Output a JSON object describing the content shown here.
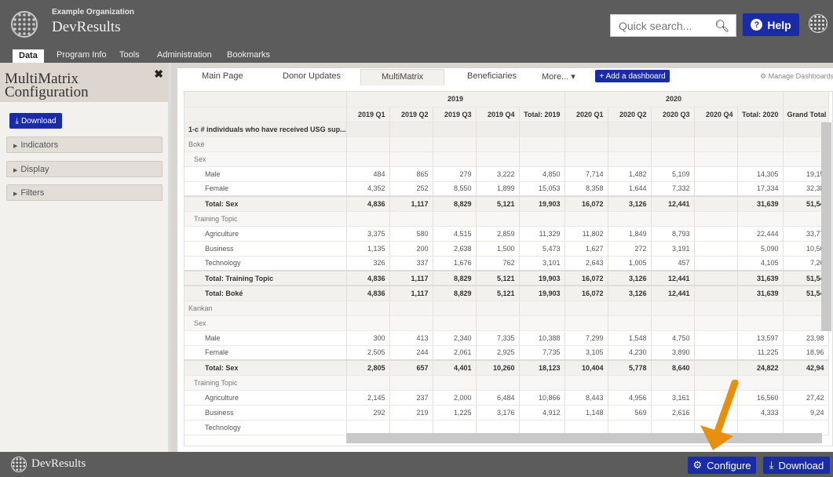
{
  "header": {
    "org_name": "Example Organization",
    "app_name": "DevResults",
    "search_placeholder": "Quick search...",
    "help_label": "Help"
  },
  "nav": [
    "Data",
    "Program Info",
    "Tools",
    "Administration",
    "Bookmarks"
  ],
  "sidebar": {
    "title": "MultiMatrix Configuration",
    "download_label": "Download",
    "sections": [
      "Indicators",
      "Display",
      "Filters"
    ]
  },
  "tabs": [
    "Main Page",
    "Donor Updates",
    "MultiMatrix",
    "Beneficiaries",
    "More..."
  ],
  "add_dashboard_label": "+ Add a dashboard",
  "manage_label": "Manage Dashboards",
  "table": {
    "year_headers": [
      "2019",
      "2020"
    ],
    "columns": [
      "2019 Q1",
      "2019 Q2",
      "2019 Q3",
      "2019 Q4",
      "Total: 2019",
      "2020 Q1",
      "2020 Q2",
      "2020 Q3",
      "2020 Q4",
      "Total: 2020",
      "Grand Total"
    ],
    "rows": [
      {
        "type": "ind",
        "label": "1-c # individuals who have received USG sup...",
        "values": []
      },
      {
        "type": "grp",
        "label": "Boké",
        "values": []
      },
      {
        "type": "sub",
        "label": "Sex",
        "values": []
      },
      {
        "type": "data",
        "label": "Male",
        "values": [
          "484",
          "865",
          "279",
          "3,222",
          "4,850",
          "7,714",
          "1,482",
          "5,109",
          "",
          "14,305",
          "19,15"
        ]
      },
      {
        "type": "data",
        "label": "Female",
        "values": [
          "4,352",
          "252",
          "8,550",
          "1,899",
          "15,053",
          "8,358",
          "1,644",
          "7,332",
          "",
          "17,334",
          "32,38"
        ]
      },
      {
        "type": "total",
        "label": "Total: Sex",
        "values": [
          "4,836",
          "1,117",
          "8,829",
          "5,121",
          "19,903",
          "16,072",
          "3,126",
          "12,441",
          "",
          "31,639",
          "51,54"
        ]
      },
      {
        "type": "sub",
        "label": "Training Topic",
        "values": []
      },
      {
        "type": "data",
        "label": "Agriculture",
        "values": [
          "3,375",
          "580",
          "4,515",
          "2,859",
          "11,329",
          "11,802",
          "1,849",
          "8,793",
          "",
          "22,444",
          "33,77"
        ]
      },
      {
        "type": "data",
        "label": "Business",
        "values": [
          "1,135",
          "200",
          "2,638",
          "1,500",
          "5,473",
          "1,627",
          "272",
          "3,191",
          "",
          "5,090",
          "10,56"
        ]
      },
      {
        "type": "data",
        "label": "Technology",
        "values": [
          "326",
          "337",
          "1,676",
          "762",
          "3,101",
          "2,643",
          "1,005",
          "457",
          "",
          "4,105",
          "7,20"
        ]
      },
      {
        "type": "total",
        "label": "Total: Training Topic",
        "values": [
          "4,836",
          "1,117",
          "8,829",
          "5,121",
          "19,903",
          "16,072",
          "3,126",
          "12,441",
          "",
          "31,639",
          "51,54"
        ]
      },
      {
        "type": "total",
        "label": "Total: Boké",
        "values": [
          "4,836",
          "1,117",
          "8,829",
          "5,121",
          "19,903",
          "16,072",
          "3,126",
          "12,441",
          "",
          "31,639",
          "51,54"
        ]
      },
      {
        "type": "grp",
        "label": "Kankan",
        "values": []
      },
      {
        "type": "sub",
        "label": "Sex",
        "values": []
      },
      {
        "type": "data",
        "label": "Male",
        "values": [
          "300",
          "413",
          "2,340",
          "7,335",
          "10,388",
          "7,299",
          "1,548",
          "4,750",
          "",
          "13,597",
          "23,98"
        ]
      },
      {
        "type": "data",
        "label": "Female",
        "values": [
          "2,505",
          "244",
          "2,061",
          "2,925",
          "7,735",
          "3,105",
          "4,230",
          "3,890",
          "",
          "11,225",
          "18,96"
        ]
      },
      {
        "type": "total",
        "label": "Total: Sex",
        "values": [
          "2,805",
          "657",
          "4,401",
          "10,260",
          "18,123",
          "10,404",
          "5,778",
          "8,640",
          "",
          "24,822",
          "42,94"
        ]
      },
      {
        "type": "sub",
        "label": "Training Topic",
        "values": []
      },
      {
        "type": "data",
        "label": "Agriculture",
        "values": [
          "2,145",
          "237",
          "2,000",
          "6,484",
          "10,866",
          "8,443",
          "4,956",
          "3,161",
          "",
          "16,560",
          "27,42"
        ]
      },
      {
        "type": "data",
        "label": "Business",
        "values": [
          "292",
          "219",
          "1,225",
          "3,176",
          "4,912",
          "1,148",
          "569",
          "2,616",
          "",
          "4,333",
          "9,24"
        ]
      },
      {
        "type": "data",
        "label": "Technology",
        "values": [
          "",
          "",
          "",
          "",
          "",
          "",
          "",
          "",
          "",
          "",
          ""
        ]
      }
    ]
  },
  "footer": {
    "brand": "DevResults",
    "configure_label": "Configure",
    "download_label": "Download"
  },
  "colors": {
    "accent": "#1a2ba8",
    "header_bg": "#5c5c5c",
    "arrow": "#e8900c"
  },
  "icons": {
    "search": "search-icon",
    "help": "question-circle-icon",
    "close": "close-icon",
    "download": "download-icon",
    "gear": "gear-icon"
  }
}
